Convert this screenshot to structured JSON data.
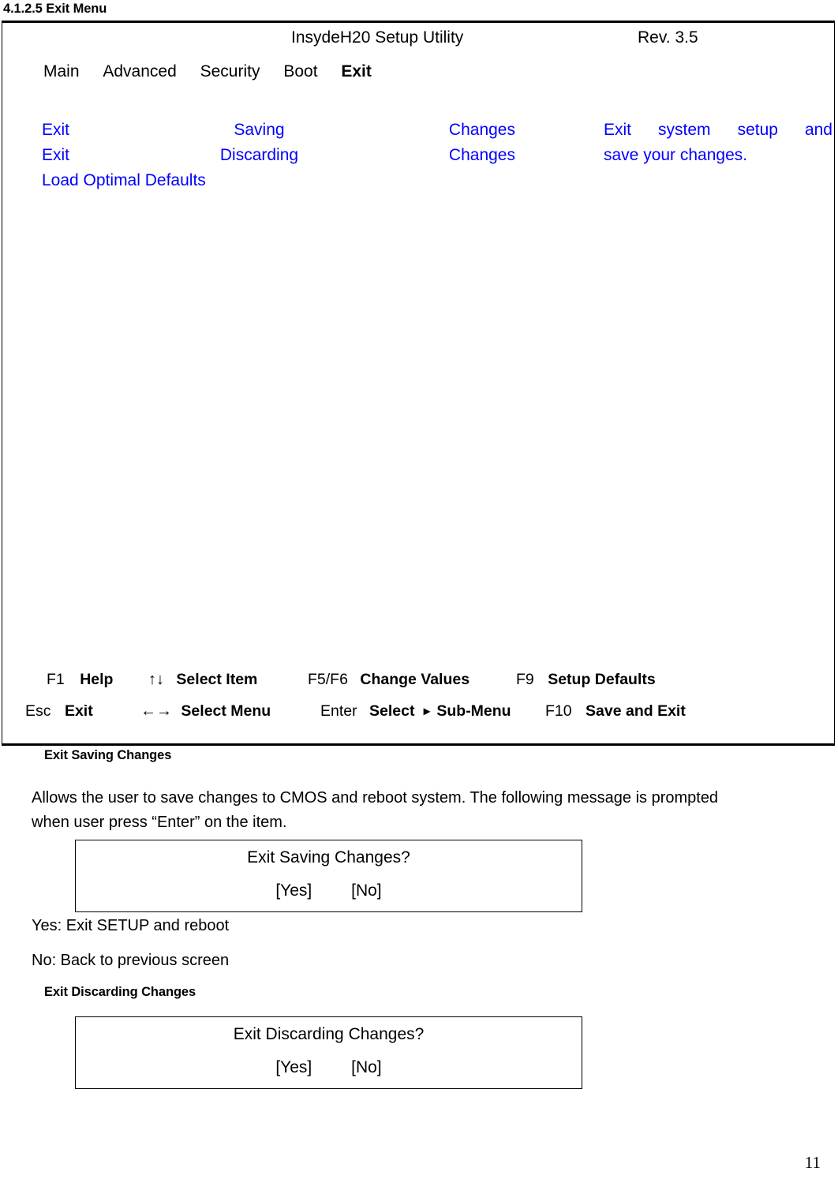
{
  "document": {
    "section_heading": "4.1.2.5 Exit Menu",
    "page_number": "11"
  },
  "bios": {
    "title": "InsydeH20 Setup Utility",
    "revision": "Rev. 3.5",
    "menu_tabs": [
      {
        "label": "Main",
        "active": false
      },
      {
        "label": "Advanced",
        "active": false
      },
      {
        "label": "Security",
        "active": false
      },
      {
        "label": "Boot",
        "active": false
      },
      {
        "label": "Exit",
        "active": true
      }
    ],
    "options": [
      {
        "word1": "Exit",
        "word2": "Saving",
        "word3": "Changes"
      },
      {
        "word1": "Exit",
        "word2": "Discarding",
        "word3": "Changes"
      }
    ],
    "option_last": "Load Optimal Defaults",
    "help": {
      "line1_w1": "Exit",
      "line1_w2": "system",
      "line1_w3": "setup",
      "line1_w4": "and",
      "line2": "save your changes."
    },
    "legend_row1": [
      {
        "key": "F1",
        "desc": "Help"
      },
      {
        "key": "↑↓",
        "desc": "Select Item",
        "key_is_arrow": true
      },
      {
        "key": "F5/F6",
        "desc": "Change Values"
      },
      {
        "key": "F9",
        "desc": "Setup Defaults"
      }
    ],
    "legend_row2": [
      {
        "key": "Esc",
        "desc": "Exit"
      },
      {
        "key": "←→",
        "desc": "Select Menu",
        "key_is_arrow": true
      },
      {
        "key": "Enter",
        "desc_pre": "Select",
        "arrow": "▸",
        "desc": "Sub-Menu"
      },
      {
        "key": "F10",
        "desc": "Save and Exit"
      }
    ]
  },
  "sections": [
    {
      "heading": "Exit Saving Changes",
      "paragraph": "Allows the user to save changes to CMOS and reboot system. The following message is prompted when user press “Enter” on the item.",
      "prompt": {
        "question": "Exit Saving Changes?",
        "yes": "[Yes]",
        "no": "[No]"
      },
      "notes": [
        "Yes: Exit SETUP and reboot",
        "No: Back to previous screen"
      ]
    },
    {
      "heading": "Exit Discarding Changes",
      "prompt": {
        "question": "Exit Discarding Changes?",
        "yes": "[Yes]",
        "no": "[No]"
      }
    }
  ],
  "colors": {
    "option_blue": "#0000ff",
    "text_black": "#000000",
    "background": "#ffffff"
  }
}
